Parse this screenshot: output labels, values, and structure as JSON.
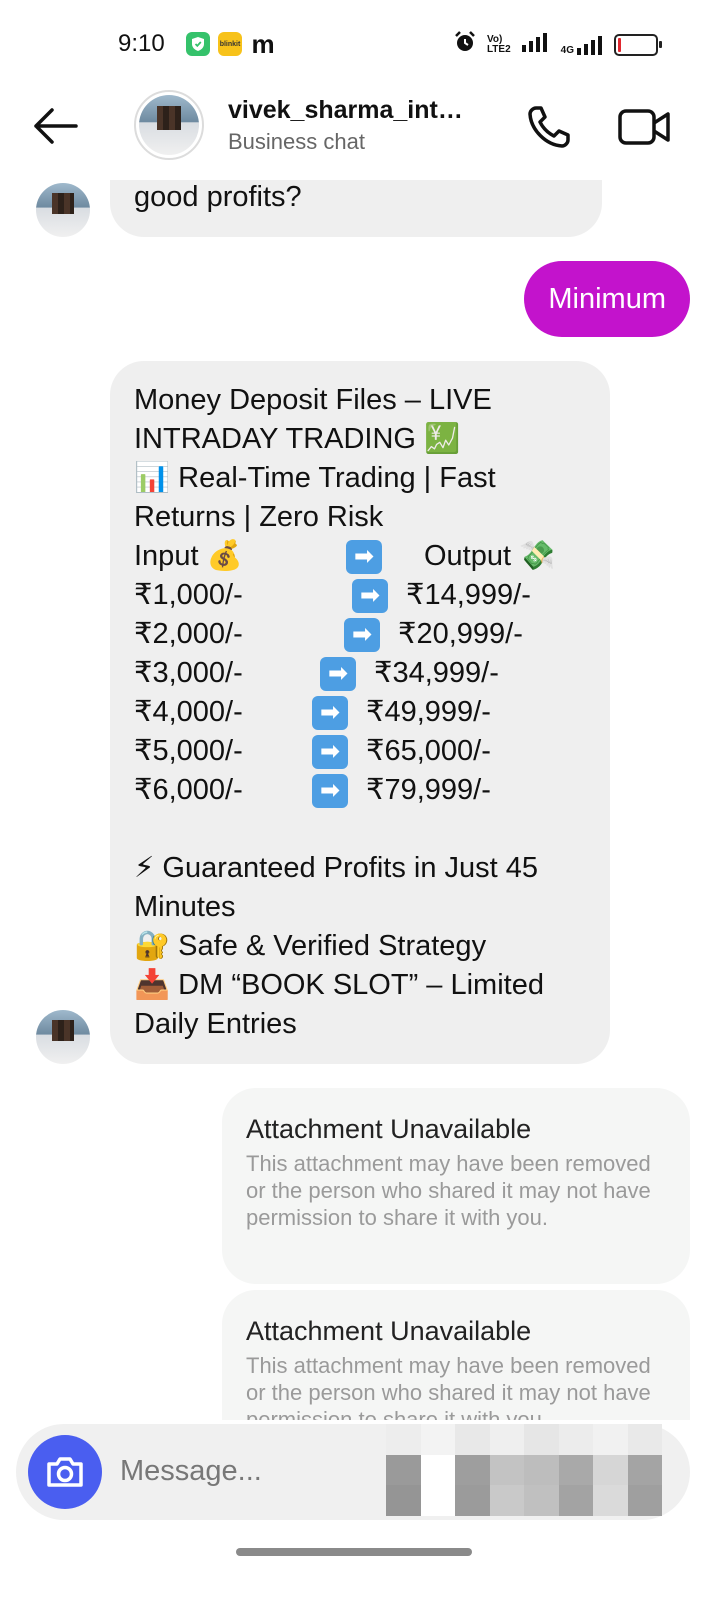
{
  "status_bar": {
    "time": "9:10",
    "app_icons": [
      "shield-app-icon",
      "blinkit-app-icon",
      "m-app-icon"
    ],
    "blinkit_label": "blinkit",
    "m_label": "m",
    "volte_label_top": "Vo)",
    "volte_label_bottom": "LTE2",
    "network_label": "4G",
    "battery_level_fraction": 0.08,
    "battery_color": "#e0282f"
  },
  "header": {
    "name": "vivek_sharma_int…",
    "subtitle": "Business chat"
  },
  "messages": {
    "partial_in_text": "good profits?",
    "out_text": "Minimum",
    "out_color": "#c313cc",
    "big_in": {
      "line1": "Money Deposit Files – LIVE",
      "line2": "INTRADAY TRADING 💹",
      "line3": "📊 Real-Time Trading | Fast",
      "line4": "Returns | Zero Risk",
      "header_in": "Input 💰",
      "header_arrow": "➡",
      "header_out": "Output 💸",
      "rows": [
        {
          "in": "₹1,000/-",
          "out": "₹14,999/-"
        },
        {
          "in": "₹2,000/-",
          "out": "₹20,999/-"
        },
        {
          "in": "₹3,000/-",
          "out": "₹34,999/-"
        },
        {
          "in": "₹4,000/-",
          "out": "₹49,999/-"
        },
        {
          "in": "₹5,000/-",
          "out": "₹65,000/-"
        },
        {
          "in": "₹6,000/-",
          "out": "₹79,999/-"
        }
      ],
      "arrow": "➡",
      "line5": "⚡ Guaranteed Profits in Just 45",
      "line6": "Minutes",
      "line7": "🔐 Safe & Verified Strategy",
      "line8": "📥 DM “BOOK SLOT” – Limited",
      "line9": "Daily Entries"
    },
    "attachments": [
      {
        "title": "Attachment Unavailable",
        "body": "This attachment may have been removed or the person who shared it may not have permission to share it with you."
      },
      {
        "title": "Attachment Unavailable",
        "body": "This attachment may have been removed or the person who shared it may not have permission to share it with you."
      }
    ]
  },
  "composer": {
    "placeholder": "Message..."
  },
  "colors": {
    "accent_camera": "#4a5ef0",
    "arrow_emoji_bg": "#4d9ee3"
  }
}
